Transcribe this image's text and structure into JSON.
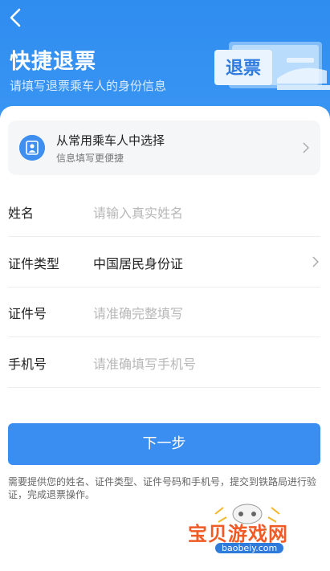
{
  "header": {
    "title": "快捷退票",
    "subtitle": "请填写退票乘车人的身份信息",
    "illustration_text": "退票",
    "accent": "#3a8ef2"
  },
  "passenger_picker": {
    "title": "从常用乘车人中选择",
    "subtitle": "信息填写更便捷"
  },
  "form": {
    "name": {
      "label": "姓名",
      "placeholder": "请输入真实姓名"
    },
    "id_type": {
      "label": "证件类型",
      "value": "中国居民身份证"
    },
    "id_number": {
      "label": "证件号",
      "placeholder": "请准确完整填写"
    },
    "phone": {
      "label": "手机号",
      "placeholder": "请准确填写手机号"
    }
  },
  "actions": {
    "next_label": "下一步"
  },
  "notice": "需要提供您的姓名、证件类型、证件号码和手机号，提交到铁路局进行验证，完成退票操作。",
  "watermark": {
    "text": "宝贝游戏网",
    "url": "baobeiy.com"
  }
}
